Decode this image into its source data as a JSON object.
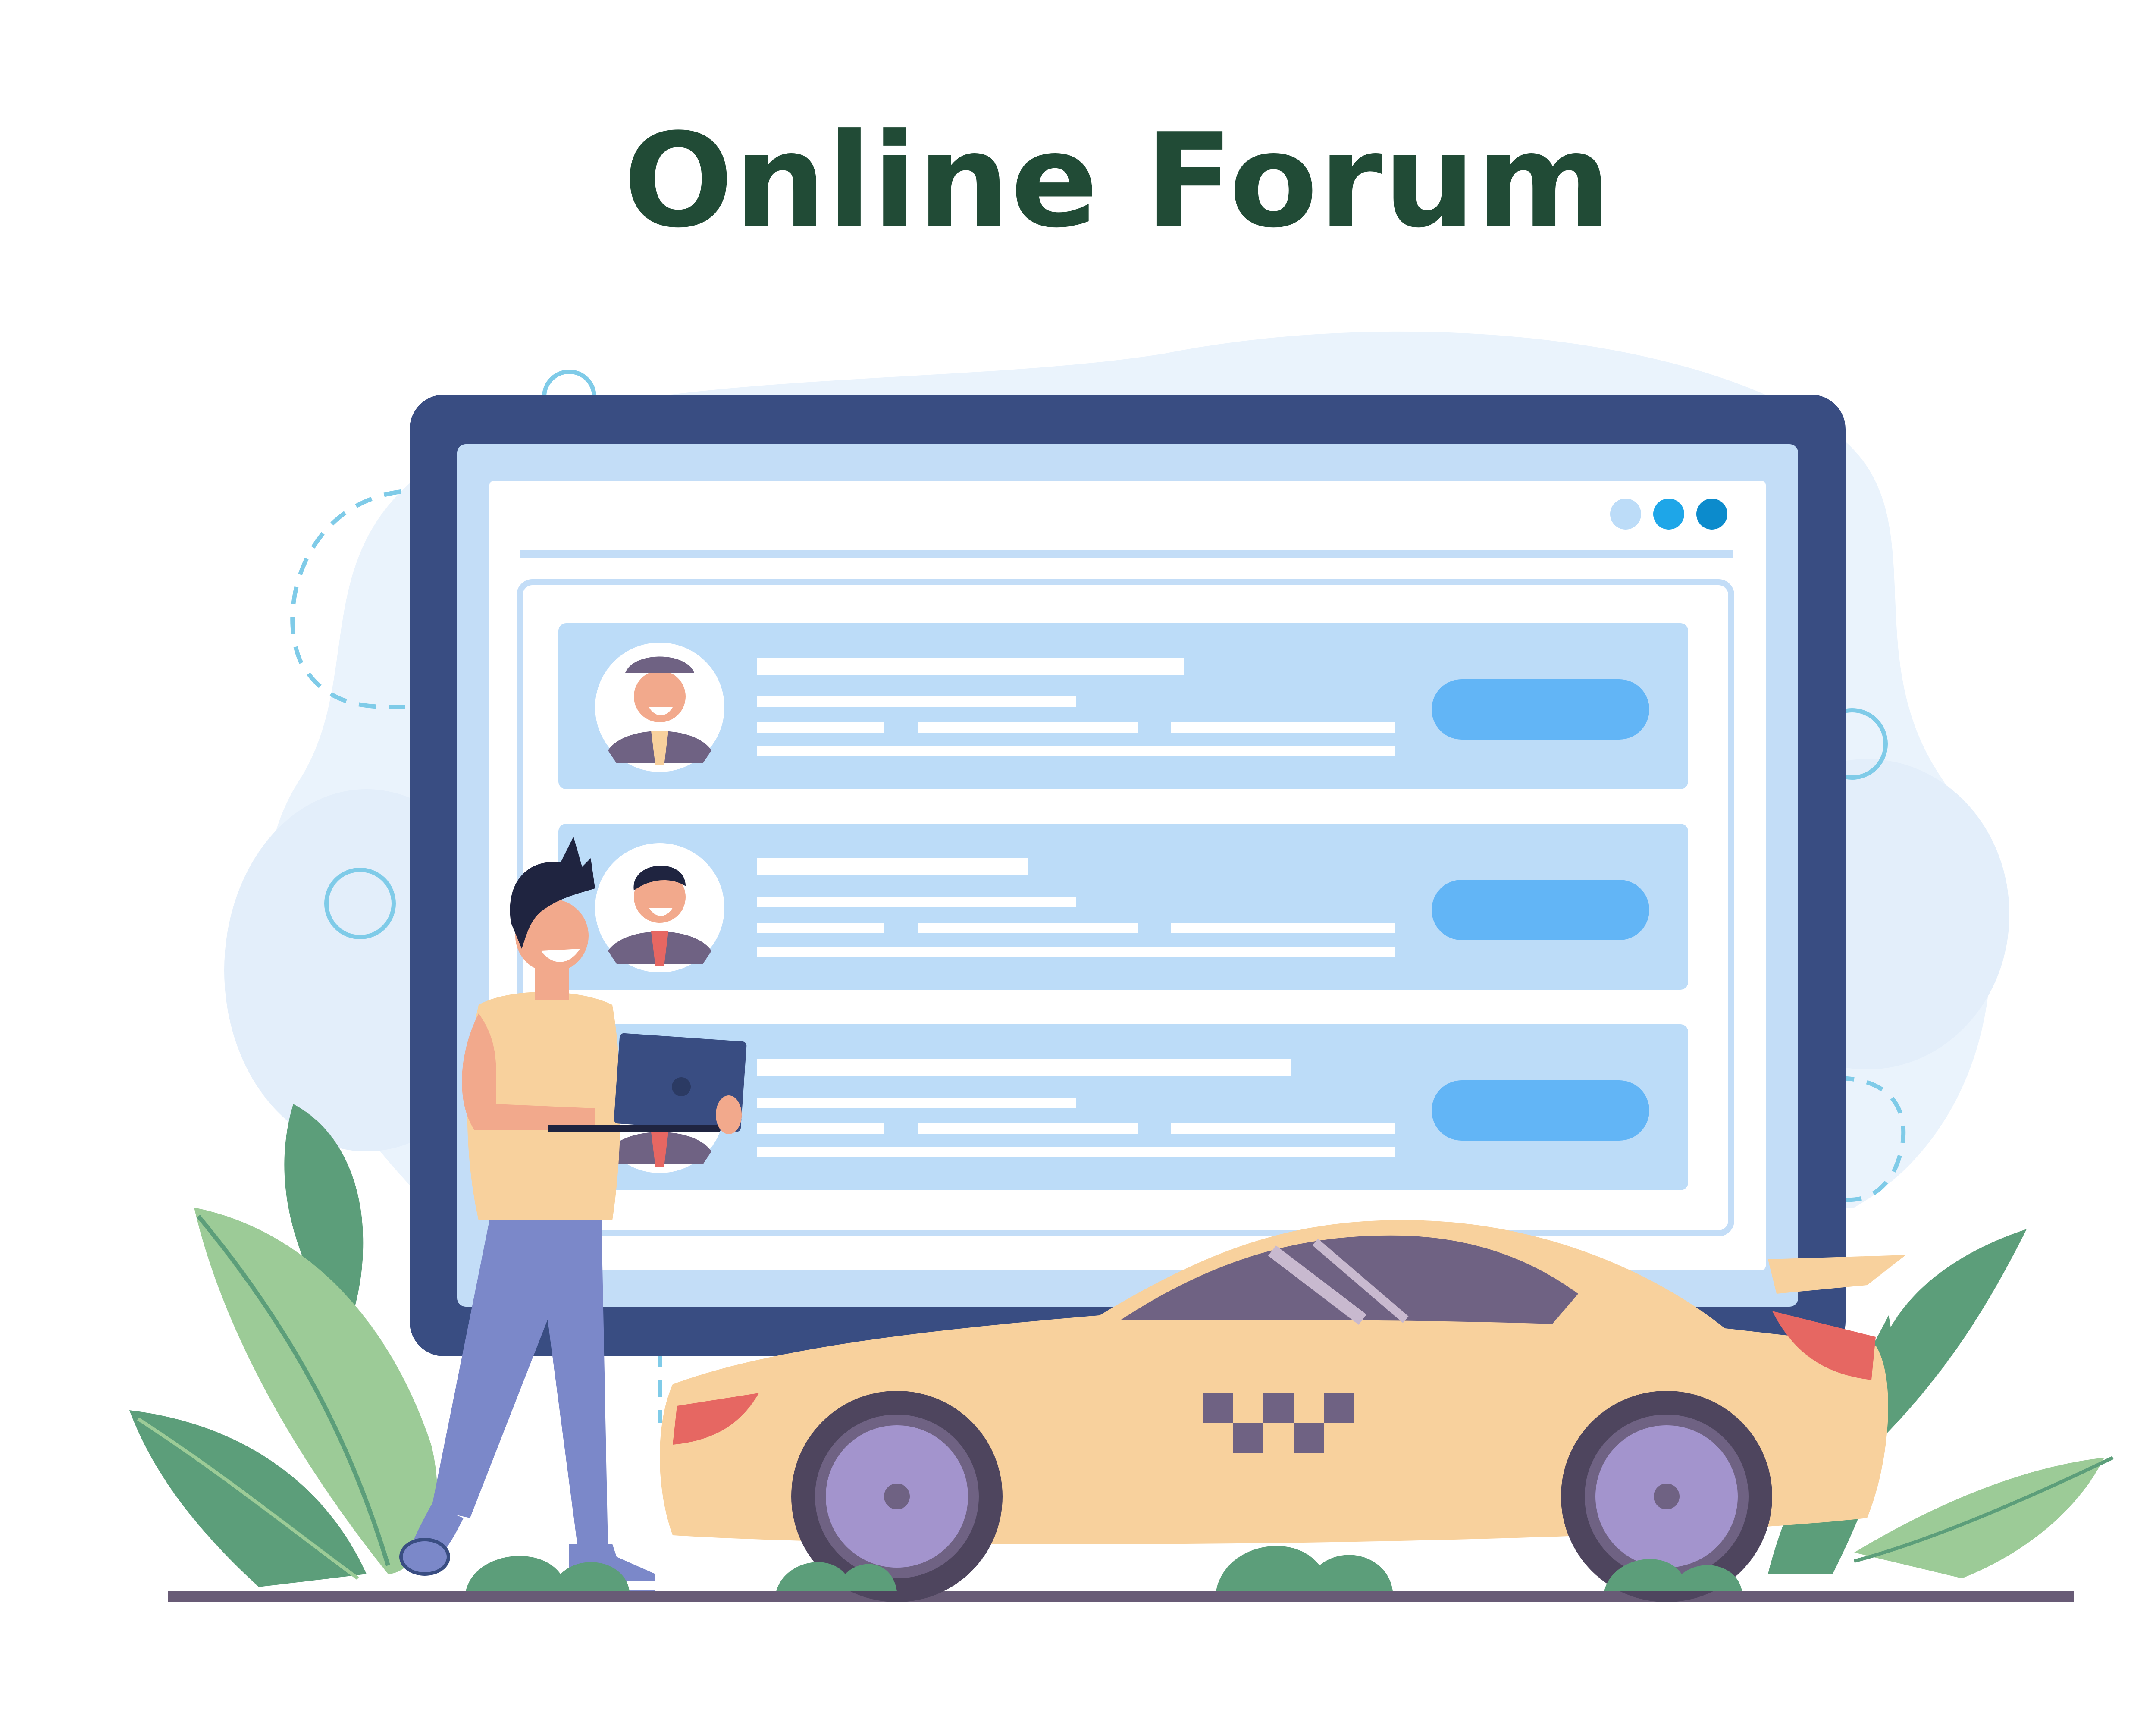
{
  "title": "Online Forum",
  "colors": {
    "title": "#214b36",
    "monitor_frame": "#394d82",
    "screen_bg": "#c3ddf7",
    "page_bg": "#ffffff",
    "row_bg": "#bcdcf8",
    "row_button": "#62b5f6",
    "text_line": "#ffffff",
    "taxi_body": "#f8d19d",
    "leaf_green": "#5c9e7a",
    "leaf_light": "#9ccb97",
    "ground": "#685b76"
  },
  "window_dots": [
    "#bcdcf8",
    "#1ea6e8",
    "#0c8bcc"
  ],
  "forum_rows": [
    {
      "avatar": "chauffeur-avatar"
    },
    {
      "avatar": "businessman-avatar"
    },
    {
      "avatar": "businessman-avatar"
    }
  ],
  "illustration": {
    "person": "man-holding-laptop",
    "vehicle": "taxi-sports-car",
    "taxi_sign": "checker-pattern"
  }
}
